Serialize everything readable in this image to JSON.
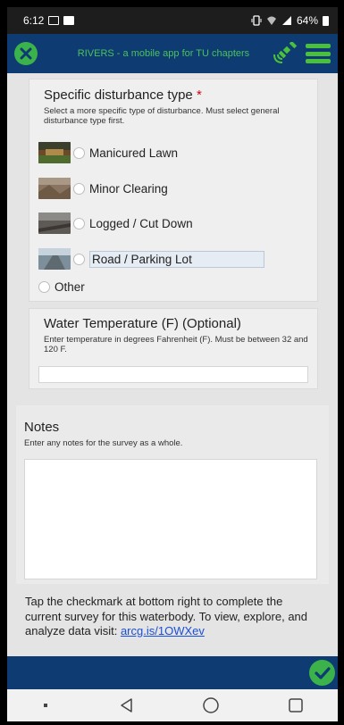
{
  "status_bar": {
    "time": "6:12",
    "battery": "64%"
  },
  "app": {
    "title": "RIVERS - a mobile app for TU chapters"
  },
  "disturbance": {
    "label": "Specific disturbance type",
    "required_marker": "*",
    "hint": "Select a more specific type of disturbance. Must select general disturbance type first.",
    "options": [
      {
        "label": "Manicured Lawn",
        "thumb_color": "#6b4a2a"
      },
      {
        "label": "Minor Clearing",
        "thumb_color": "#8a7360"
      },
      {
        "label": "Logged / Cut Down",
        "thumb_color": "#5d5a55"
      },
      {
        "label": "Road / Parking Lot",
        "thumb_color": "#7d8f9a"
      },
      {
        "label": "Other"
      }
    ]
  },
  "water_temp": {
    "label": "Water Temperature (F) (Optional)",
    "hint": "Enter temperature in degrees Fahrenheit (F). Must be between 32 and 120 F.",
    "value": ""
  },
  "notes": {
    "label": "Notes",
    "hint": "Enter any notes for the survey as a whole.",
    "value": ""
  },
  "footer": {
    "text": "Tap the checkmark at bottom right to complete the current survey for this waterbody. To view, explore, and analyze data visit: ",
    "link": "arcg.is/1OWXev"
  },
  "colors": {
    "header": "#0f3b73",
    "accent_green": "#3bb34a",
    "required": "#d0021b",
    "link": "#1a4fd6"
  },
  "icons": [
    "close-icon",
    "satellite-icon",
    "menu-icon",
    "checkmark-icon",
    "back-icon",
    "home-icon",
    "recents-icon"
  ]
}
